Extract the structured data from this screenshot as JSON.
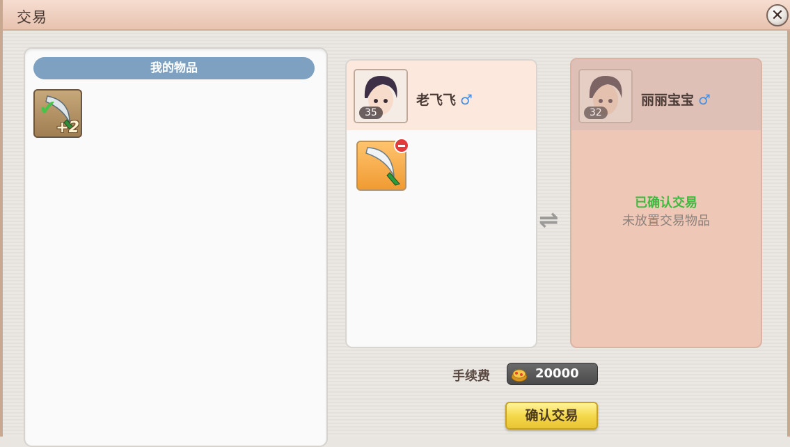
{
  "window": {
    "title": "交易",
    "close_icon": "close-icon"
  },
  "inventory": {
    "header": "我的物品",
    "items": [
      {
        "icon": "sword-icon",
        "enhance": "+2",
        "equipped": true
      }
    ]
  },
  "my_trade": {
    "name": "老飞飞",
    "gender_icon": "♂",
    "level": "35",
    "items": [
      {
        "icon": "sword-icon",
        "removable": true
      }
    ]
  },
  "partner_trade": {
    "name": "丽丽宝宝",
    "gender_icon": "♂",
    "level": "32",
    "status_confirmed": "已确认交易",
    "status_empty": "未放置交易物品"
  },
  "fee": {
    "label": "手续费",
    "value": "20000",
    "icon": "gold-coin-icon"
  },
  "confirm_button": "确认交易",
  "colors": {
    "header_blue": "#7ea1c1",
    "confirm_yellow": "#f5d94c",
    "confirmed_green": "#40b93f"
  }
}
